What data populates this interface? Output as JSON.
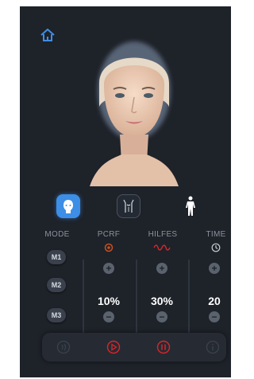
{
  "header": {
    "home_icon": "home-icon"
  },
  "preview": {
    "subject": "face-portrait"
  },
  "view_modes": [
    {
      "icon": "face-head-icon",
      "active": true
    },
    {
      "icon": "upper-body-icon",
      "active": false
    },
    {
      "icon": "full-body-icon",
      "active": false
    }
  ],
  "columns": {
    "mode": "MODE",
    "pcrf": "PCRF",
    "hilfes": "HILFES",
    "time": "TIME"
  },
  "modes": [
    "M1",
    "M2",
    "M3"
  ],
  "values": {
    "pcrf": "10%",
    "hilfes": "30%",
    "time": "20"
  },
  "controls": {
    "plus": "+",
    "minus": "−",
    "buttons": [
      "sound-icon",
      "play-icon",
      "pause-icon",
      "info-icon"
    ]
  },
  "colors": {
    "accent_blue": "#3d8ee6",
    "accent_red": "#d8262b",
    "panel_bg": "#1e2229"
  }
}
